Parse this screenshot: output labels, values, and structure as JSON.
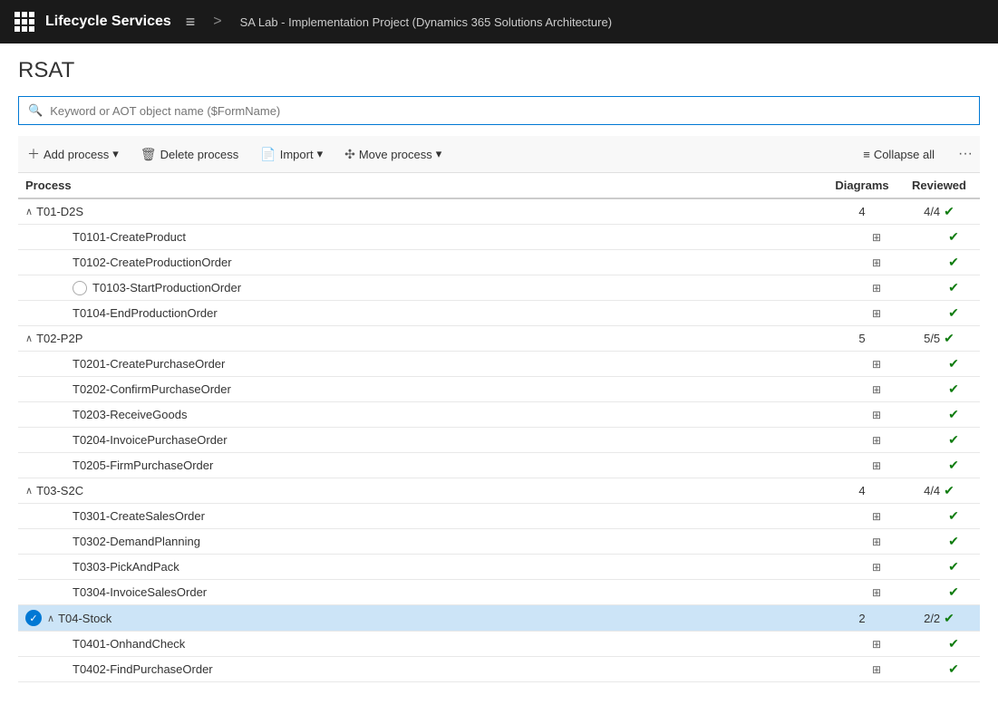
{
  "header": {
    "app_title": "Lifecycle Services",
    "menu_icon": "≡",
    "separator": ">",
    "breadcrumb": "SA Lab - Implementation Project (Dynamics 365 Solutions Architecture)"
  },
  "page": {
    "title": "RSAT",
    "search_placeholder": "Keyword or AOT object name ($FormName)"
  },
  "toolbar": {
    "add_process": "Add process",
    "delete_process": "Delete process",
    "import": "Import",
    "move_process": "Move process",
    "collapse_all": "Collapse all"
  },
  "table": {
    "col_process": "Process",
    "col_diagrams": "Diagrams",
    "col_reviewed": "Reviewed",
    "groups": [
      {
        "id": "T01-D2S",
        "label": "T01-D2S",
        "diagrams": "4",
        "reviewed": "4/4",
        "expanded": true,
        "selected": false,
        "has_radio": false,
        "has_check": false,
        "children": [
          {
            "id": "T0101",
            "label": "T0101-CreateProduct",
            "has_radio": false,
            "selected": false
          },
          {
            "id": "T0102",
            "label": "T0102-CreateProductionOrder",
            "has_radio": false,
            "selected": false
          },
          {
            "id": "T0103",
            "label": "T0103-StartProductionOrder",
            "has_radio": true,
            "selected": false
          },
          {
            "id": "T0104",
            "label": "T0104-EndProductionOrder",
            "has_radio": false,
            "selected": false
          }
        ]
      },
      {
        "id": "T02-P2P",
        "label": "T02-P2P",
        "diagrams": "5",
        "reviewed": "5/5",
        "expanded": true,
        "selected": false,
        "has_radio": false,
        "has_check": false,
        "children": [
          {
            "id": "T0201",
            "label": "T0201-CreatePurchaseOrder",
            "has_radio": false,
            "selected": false
          },
          {
            "id": "T0202",
            "label": "T0202-ConfirmPurchaseOrder",
            "has_radio": false,
            "selected": false
          },
          {
            "id": "T0203",
            "label": "T0203-ReceiveGoods",
            "has_radio": false,
            "selected": false
          },
          {
            "id": "T0204",
            "label": "T0204-InvoicePurchaseOrder",
            "has_radio": false,
            "selected": false
          },
          {
            "id": "T0205",
            "label": "T0205-FirmPurchaseOrder",
            "has_radio": false,
            "selected": false
          }
        ]
      },
      {
        "id": "T03-S2C",
        "label": "T03-S2C",
        "diagrams": "4",
        "reviewed": "4/4",
        "expanded": true,
        "selected": false,
        "has_radio": false,
        "has_check": false,
        "children": [
          {
            "id": "T0301",
            "label": "T0301-CreateSalesOrder",
            "has_radio": false,
            "selected": false
          },
          {
            "id": "T0302",
            "label": "T0302-DemandPlanning",
            "has_radio": false,
            "selected": false
          },
          {
            "id": "T0303",
            "label": "T0303-PickAndPack",
            "has_radio": false,
            "selected": false
          },
          {
            "id": "T0304",
            "label": "T0304-InvoiceSalesOrder",
            "has_radio": false,
            "selected": false
          }
        ]
      },
      {
        "id": "T04-Stock",
        "label": "T04-Stock",
        "diagrams": "2",
        "reviewed": "2/2",
        "expanded": true,
        "selected": true,
        "has_radio": false,
        "has_check": true,
        "children": [
          {
            "id": "T0401",
            "label": "T0401-OnhandCheck",
            "has_radio": false,
            "selected": false
          },
          {
            "id": "T0402",
            "label": "T0402-FindPurchaseOrder",
            "has_radio": false,
            "selected": false
          }
        ]
      }
    ]
  }
}
